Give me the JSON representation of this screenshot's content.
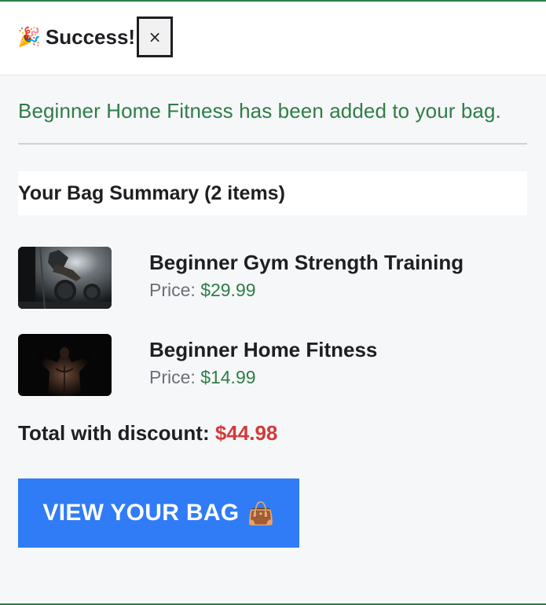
{
  "header": {
    "title": "Success!",
    "party_icon": "🎉",
    "close_label": "×"
  },
  "message": "Beginner Home Fitness has been added to your bag.",
  "summary": {
    "heading": "Your Bag Summary (2 items)"
  },
  "items": [
    {
      "name": "Beginner Gym Strength Training",
      "price_label": "Price:",
      "price": "$29.99",
      "thumbnail": "gym-strength-training-image"
    },
    {
      "name": "Beginner Home Fitness",
      "price_label": "Price:",
      "price": "$14.99",
      "thumbnail": "home-fitness-image"
    }
  ],
  "total": {
    "label": "Total with discount:",
    "amount": "$44.98"
  },
  "view_bag": {
    "label": "VIEW YOUR BAG",
    "icon": "👜"
  },
  "colors": {
    "accent_green": "#2e7d46",
    "total_red": "#d23a3a",
    "button_blue": "#2f7cf6"
  }
}
